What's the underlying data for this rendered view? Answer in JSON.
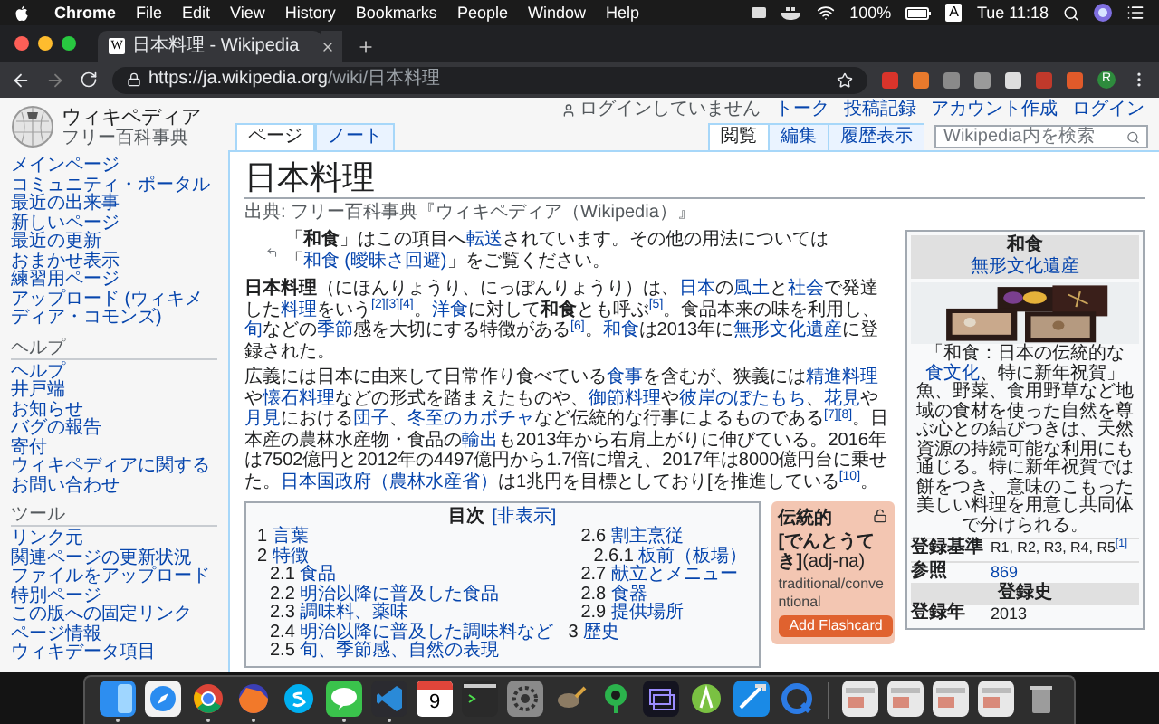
{
  "menubar": {
    "items": [
      "Chrome",
      "File",
      "Edit",
      "View",
      "History",
      "Bookmarks",
      "People",
      "Window",
      "Help"
    ],
    "battery": "100%",
    "input_source": "A",
    "clock": "Tue 11:18"
  },
  "browser": {
    "tab": {
      "favicon": "W",
      "title": "日本料理 - Wikipedia"
    },
    "url_host": "https://ja.wikipedia.org",
    "url_path": "/wiki/日本料理",
    "profile": "R"
  },
  "personal": [
    {
      "label": "ログインしていません",
      "kind": "status"
    },
    {
      "label": "トーク",
      "kind": "link"
    },
    {
      "label": "投稿記録",
      "kind": "link"
    },
    {
      "label": "アカウント作成",
      "kind": "link"
    },
    {
      "label": "ログイン",
      "kind": "link"
    }
  ],
  "logo": {
    "name": "ウィキペディア",
    "tagline": "フリー百科事典"
  },
  "sidebar": [
    {
      "items": [
        "メインページ",
        "コミュニティ・ポータル",
        "最近の出来事",
        "新しいページ",
        "最近の更新",
        "おまかせ表示",
        "練習用ページ",
        "アップロード (ウィキメディア・コモンズ)"
      ]
    },
    {
      "heading": "ヘルプ",
      "items": [
        "ヘルプ",
        "井戸端",
        "お知らせ",
        "バグの報告",
        "寄付",
        "ウィキペディアに関するお問い合わせ"
      ]
    },
    {
      "heading": "ツール",
      "items": [
        "リンク元",
        "関連ページの更新状況",
        "ファイルをアップロード",
        "特別ページ",
        "この版への固定リンク",
        "ページ情報",
        "ウィキデータ項目"
      ]
    }
  ],
  "page_tabs": [
    {
      "label": "ページ",
      "selected": true
    },
    {
      "label": "ノート",
      "selected": false
    }
  ],
  "view_tabs": [
    {
      "label": "閲覧",
      "selected": true
    },
    {
      "label": "編集",
      "selected": false
    },
    {
      "label": "履歴表示",
      "selected": false
    }
  ],
  "search": {
    "placeholder": "Wikipedia内を検索"
  },
  "article": {
    "title": "日本料理",
    "subtitle": "出典: フリー百科事典『ウィキペディア（Wikipedia）』",
    "hatnote": [
      {
        "kind": "text",
        "text": "「"
      },
      {
        "kind": "bold",
        "text": "和食"
      },
      {
        "kind": "text",
        "text": "」はこの項目へ"
      },
      {
        "kind": "link",
        "text": "転送"
      },
      {
        "kind": "text",
        "text": "されています。その他の用法については「"
      },
      {
        "kind": "link",
        "text": "和食 (曖昧さ回避)"
      },
      {
        "kind": "text",
        "text": "」をご覧ください。"
      }
    ],
    "paragraphs": [
      [
        {
          "kind": "bold",
          "text": "日本料理"
        },
        {
          "kind": "text",
          "text": "（にほんりょうり、にっぽんりょうり）は、"
        },
        {
          "kind": "link",
          "text": "日本"
        },
        {
          "kind": "text",
          "text": "の"
        },
        {
          "kind": "link",
          "text": "風土"
        },
        {
          "kind": "text",
          "text": "と"
        },
        {
          "kind": "link",
          "text": "社会"
        },
        {
          "kind": "text",
          "text": "で発達した"
        },
        {
          "kind": "link",
          "text": "料理"
        },
        {
          "kind": "text",
          "text": "をいう"
        },
        {
          "kind": "ref",
          "text": "[2][3][4]"
        },
        {
          "kind": "text",
          "text": "。"
        },
        {
          "kind": "link",
          "text": "洋食"
        },
        {
          "kind": "text",
          "text": "に対して"
        },
        {
          "kind": "bold",
          "text": "和食"
        },
        {
          "kind": "text",
          "text": "とも呼ぶ"
        },
        {
          "kind": "ref",
          "text": "[5]"
        },
        {
          "kind": "text",
          "text": "。食品本来の味を利用し、"
        },
        {
          "kind": "link",
          "text": "旬"
        },
        {
          "kind": "text",
          "text": "などの"
        },
        {
          "kind": "link",
          "text": "季節"
        },
        {
          "kind": "text",
          "text": "感を大切にする特徴がある"
        },
        {
          "kind": "ref",
          "text": "[6]"
        },
        {
          "kind": "text",
          "text": "。"
        },
        {
          "kind": "link",
          "text": "和食"
        },
        {
          "kind": "text",
          "text": "は2013年に"
        },
        {
          "kind": "link",
          "text": "無形文化遺産"
        },
        {
          "kind": "text",
          "text": "に登録された。"
        }
      ],
      [
        {
          "kind": "text",
          "text": "広義には日本に由来して日常作り食べている"
        },
        {
          "kind": "link",
          "text": "食事"
        },
        {
          "kind": "text",
          "text": "を含むが、狭義には"
        },
        {
          "kind": "link",
          "text": "精進料理"
        },
        {
          "kind": "text",
          "text": "や"
        },
        {
          "kind": "link",
          "text": "懐石料理"
        },
        {
          "kind": "text",
          "text": "などの形式を踏まえたものや、"
        },
        {
          "kind": "link",
          "text": "御節料理"
        },
        {
          "kind": "text",
          "text": "や"
        },
        {
          "kind": "link",
          "text": "彼岸のぼたもち"
        },
        {
          "kind": "text",
          "text": "、"
        },
        {
          "kind": "link",
          "text": "花見"
        },
        {
          "kind": "text",
          "text": "や"
        },
        {
          "kind": "link",
          "text": "月見"
        },
        {
          "kind": "text",
          "text": "における"
        },
        {
          "kind": "link",
          "text": "団子"
        },
        {
          "kind": "text",
          "text": "、"
        },
        {
          "kind": "link",
          "text": "冬至のカボチャ"
        },
        {
          "kind": "text",
          "text": "など伝統的な行事によるものである"
        },
        {
          "kind": "ref",
          "text": "[7][8]"
        },
        {
          "kind": "text",
          "text": "。日本産の農林水産物・食品の"
        },
        {
          "kind": "link",
          "text": "輸出"
        },
        {
          "kind": "text",
          "text": "も2013年から右肩上がりに伸びている。2016年は7502億円と2012年の4497億円から1.7倍に増え、2017年は8000億円台に乗せた。"
        },
        {
          "kind": "link",
          "text": "日本国政府（農林水産省）"
        },
        {
          "kind": "text",
          "text": "は1兆円を目標としており["
        },
        {
          "kind": "text",
          "text": "を推進している"
        },
        {
          "kind": "ref",
          "text": "[10]"
        },
        {
          "kind": "text",
          "text": "。"
        }
      ]
    ]
  },
  "toc": {
    "title": "目次",
    "toggle": "[非表示]",
    "items": [
      {
        "number": "1",
        "label": "言葉"
      },
      {
        "number": "2",
        "label": "特徴",
        "children": [
          {
            "number": "2.1",
            "label": "食品"
          },
          {
            "number": "2.2",
            "label": "明治以降に普及した食品"
          },
          {
            "number": "2.3",
            "label": "調味料、薬味"
          },
          {
            "number": "2.4",
            "label": "明治以降に普及した調味料など"
          },
          {
            "number": "2.5",
            "label": "旬、季節感、自然の表現"
          },
          {
            "number": "2.6",
            "label": "割主烹従",
            "children": [
              {
                "number": "2.6.1",
                "label": "板前（板場）"
              }
            ]
          },
          {
            "number": "2.7",
            "label": "献立とメニュー"
          },
          {
            "number": "2.8",
            "label": "食器"
          },
          {
            "number": "2.9",
            "label": "提供場所"
          }
        ]
      },
      {
        "number": "3",
        "label": "歴史"
      }
    ]
  },
  "popup": {
    "word": "伝統的",
    "reading": "**[でんとうてき]**(adj-na)",
    "meaning": "traditional/conventional",
    "button": "Add Flashcard",
    "locked": false
  },
  "infobox": {
    "title": "和食",
    "subtitle": "無形文化遺産",
    "caption": [
      {
        "kind": "text",
        "text": "「和食：日本の伝統的な"
      },
      {
        "kind": "link",
        "text": "食文化"
      },
      {
        "kind": "text",
        "text": "、特に新年祝賀」魚、野菜、食用野草など地域の食材を使った自然を尊ぶ心との結びつきは、天然資源の持続可能な利用にも通じる。特に新年祝賀では餅をつき、意味のこもった美しい料理を用意し共同体で分けられる。"
      }
    ],
    "rows": [
      {
        "label": "登録基準",
        "value": "R1, R2, R3, R4, R5",
        "ref": "[1]",
        "link": false
      },
      {
        "label": "参照",
        "value": "869",
        "link": true
      }
    ],
    "section": "登録史",
    "history": [
      {
        "label": "登録年",
        "value": "2013"
      }
    ]
  },
  "dock": [
    {
      "kind": "finder",
      "running": true
    },
    {
      "kind": "safari",
      "running": false
    },
    {
      "kind": "chrome",
      "running": true
    },
    {
      "kind": "firefox",
      "running": true
    },
    {
      "kind": "skype",
      "running": false
    },
    {
      "kind": "line",
      "running": true
    },
    {
      "kind": "vscode",
      "running": true
    },
    {
      "kind": "calendar",
      "running": false,
      "day": "9"
    },
    {
      "kind": "terminal",
      "running": false
    },
    {
      "kind": "settings",
      "running": false
    },
    {
      "kind": "gimp",
      "running": false
    },
    {
      "kind": "sourcetree",
      "running": false
    },
    {
      "kind": "screens",
      "running": false
    },
    {
      "kind": "android",
      "running": false
    },
    {
      "kind": "xcode",
      "running": false
    },
    {
      "kind": "quicktime",
      "running": false
    },
    {
      "kind": "separator"
    },
    {
      "kind": "window",
      "running": false
    },
    {
      "kind": "window",
      "running": false
    },
    {
      "kind": "window",
      "running": false
    },
    {
      "kind": "window",
      "running": false
    },
    {
      "kind": "trash",
      "running": false
    }
  ]
}
